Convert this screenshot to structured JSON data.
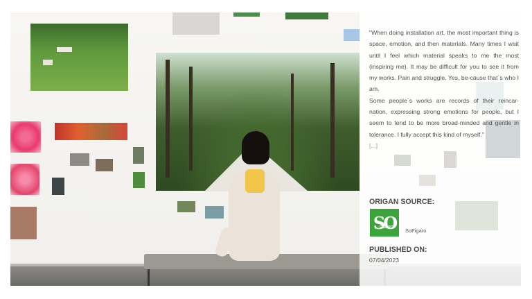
{
  "article": {
    "quote_paragraph_1": "\"When doing installation art, the most important thing is space, emotion, and then materials. Many times I wait until I feel which material speaks to me the most (inspiring me). It may be difficult for you to see it from my works. Pain and struggle. Yes, be-cause that`s who I am.",
    "quote_paragraph_2": "Some people`s works are records of their reincar-nation, expressing strong emotions for people, but I seem to tend to be more broad-minded and gentle in tolerance. I fully accept this kind of myself.\"",
    "ellipsis": "[...]"
  },
  "source": {
    "heading": "ORIGAN SOURCE:",
    "logo_mark": "SO",
    "logo_word": "FIGARO",
    "name": "SoFigaro",
    "logo_color": "#3ba53b"
  },
  "published": {
    "heading": "PUBLISHED ON:",
    "date": "07/04/2023"
  },
  "image": {
    "subject": "gallery-photo"
  }
}
